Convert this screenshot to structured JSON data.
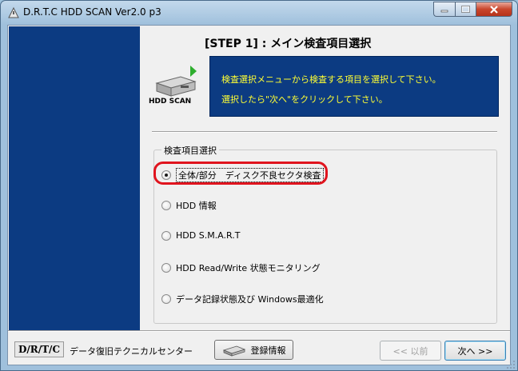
{
  "window": {
    "title": "D.R.T.C HDD SCAN Ver2.0 p3",
    "minimize_icon": "minimize-icon",
    "maximize_icon": "maximize-icon",
    "close_icon": "close-icon"
  },
  "header": {
    "step_title": "[STEP 1] : メイン検査項目選択",
    "logo_label": "HDD SCAN",
    "info_lines": [
      "検査選択メニューから検査する項目を選択して下さい。",
      "選択したら\"次へ\"をクリックして下さい。"
    ]
  },
  "group": {
    "label": "検査項目選択",
    "options": [
      {
        "label": "全体/部分　ディスク不良セクタ検査",
        "checked": true
      },
      {
        "label": "HDD 情報",
        "checked": false
      },
      {
        "label": "HDD S.M.A.R.T",
        "checked": false
      },
      {
        "label": "HDD Read/Write 状態モニタリング",
        "checked": false
      },
      {
        "label": "データ記録状態及び Windows最適化",
        "checked": false
      }
    ]
  },
  "footer": {
    "brand_badge": "D/R/T/C",
    "brand_name": "データ復旧テクニカルセンター",
    "register_label": "登録情報",
    "prev_label": "<< 以前",
    "next_label": "次へ >>"
  },
  "colors": {
    "panel_blue": "#0c3b82",
    "info_text": "#ffff33",
    "highlight_red": "#e0141e"
  }
}
